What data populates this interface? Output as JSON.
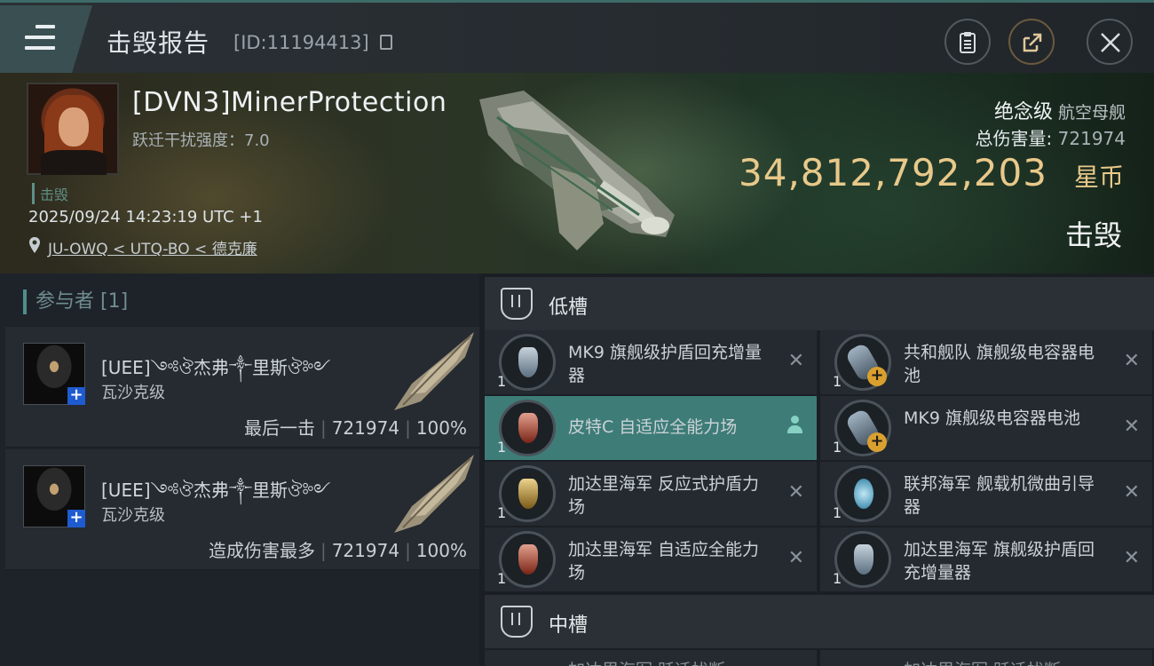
{
  "header": {
    "title": "击毁报告",
    "report_id": "[ID:11194413]",
    "buttons": {
      "clipboard": "clipboard-icon",
      "share": "share-icon",
      "close": "close-icon"
    }
  },
  "victim": {
    "name": "[DVN3]MinerProtection",
    "scram_strength": "跃迁干扰强度：7.0",
    "status_tag": "击毁",
    "datetime": "2025/09/24 14:23:19 UTC +1",
    "location": "JU-OWQ < UTQ-BO < 德克廉",
    "ship_class": "绝念级",
    "ship_type": "航空母舰",
    "total_damage_label": "总伤害量:",
    "total_damage": "721974",
    "isk_value": "34,812,792,203",
    "isk_unit": "星币",
    "result_label": "击毁"
  },
  "participants": {
    "title": "参与者 [1]",
    "items": [
      {
        "name": "[UEE]༺ঔ杰弗༒里斯ঔ༻",
        "ship": "瓦沙克级",
        "role": "最后一击",
        "damage": "721974",
        "percent": "100%"
      },
      {
        "name": "[UEE]༺ঔ杰弗༒里斯ঔ༻",
        "ship": "瓦沙克级",
        "role": "造成伤害最多",
        "damage": "721974",
        "percent": "100%"
      }
    ]
  },
  "fittings": {
    "low_slots_label": "低槽",
    "mid_slots_label": "中槽",
    "low_slots": [
      {
        "name": "MK9 旗舰级护盾回充增量器",
        "qty": "1",
        "icon": "shield-booster-icon",
        "color": "#8fa6b8",
        "status": "dropped"
      },
      {
        "name": "共和舰队 旗舰级电容器电池",
        "qty": "1",
        "icon": "capacitor-battery-icon",
        "color": "#9fb1c0",
        "status": "dropped"
      },
      {
        "name": "皮特C 自适应全能力场",
        "qty": "1",
        "icon": "adaptive-field-icon",
        "color": "#c8503a",
        "status": "highlighted"
      },
      {
        "name": "MK9 旗舰级电容器电池",
        "qty": "1",
        "icon": "capacitor-battery-icon",
        "color": "#9fb1c0",
        "status": "dropped"
      },
      {
        "name": "加达里海军 反应式护盾力场",
        "qty": "1",
        "icon": "reactive-field-icon",
        "color": "#c9a043",
        "status": "dropped"
      },
      {
        "name": "联邦海军 舰载机微曲引导器",
        "qty": "1",
        "icon": "fighter-guidance-icon",
        "color": "#5aa6c8",
        "status": "dropped"
      },
      {
        "name": "加达里海军 自适应全能力场",
        "qty": "1",
        "icon": "adaptive-field-icon",
        "color": "#c8503a",
        "status": "dropped"
      },
      {
        "name": "加达里海军 旗舰级护盾回充增量器",
        "qty": "1",
        "icon": "shield-booster-icon",
        "color": "#8fa6b8",
        "status": "dropped"
      }
    ],
    "mid_slot_peek": [
      "加达里海军 跃迁扰断",
      "加达里海军 跃迁扰断"
    ]
  }
}
